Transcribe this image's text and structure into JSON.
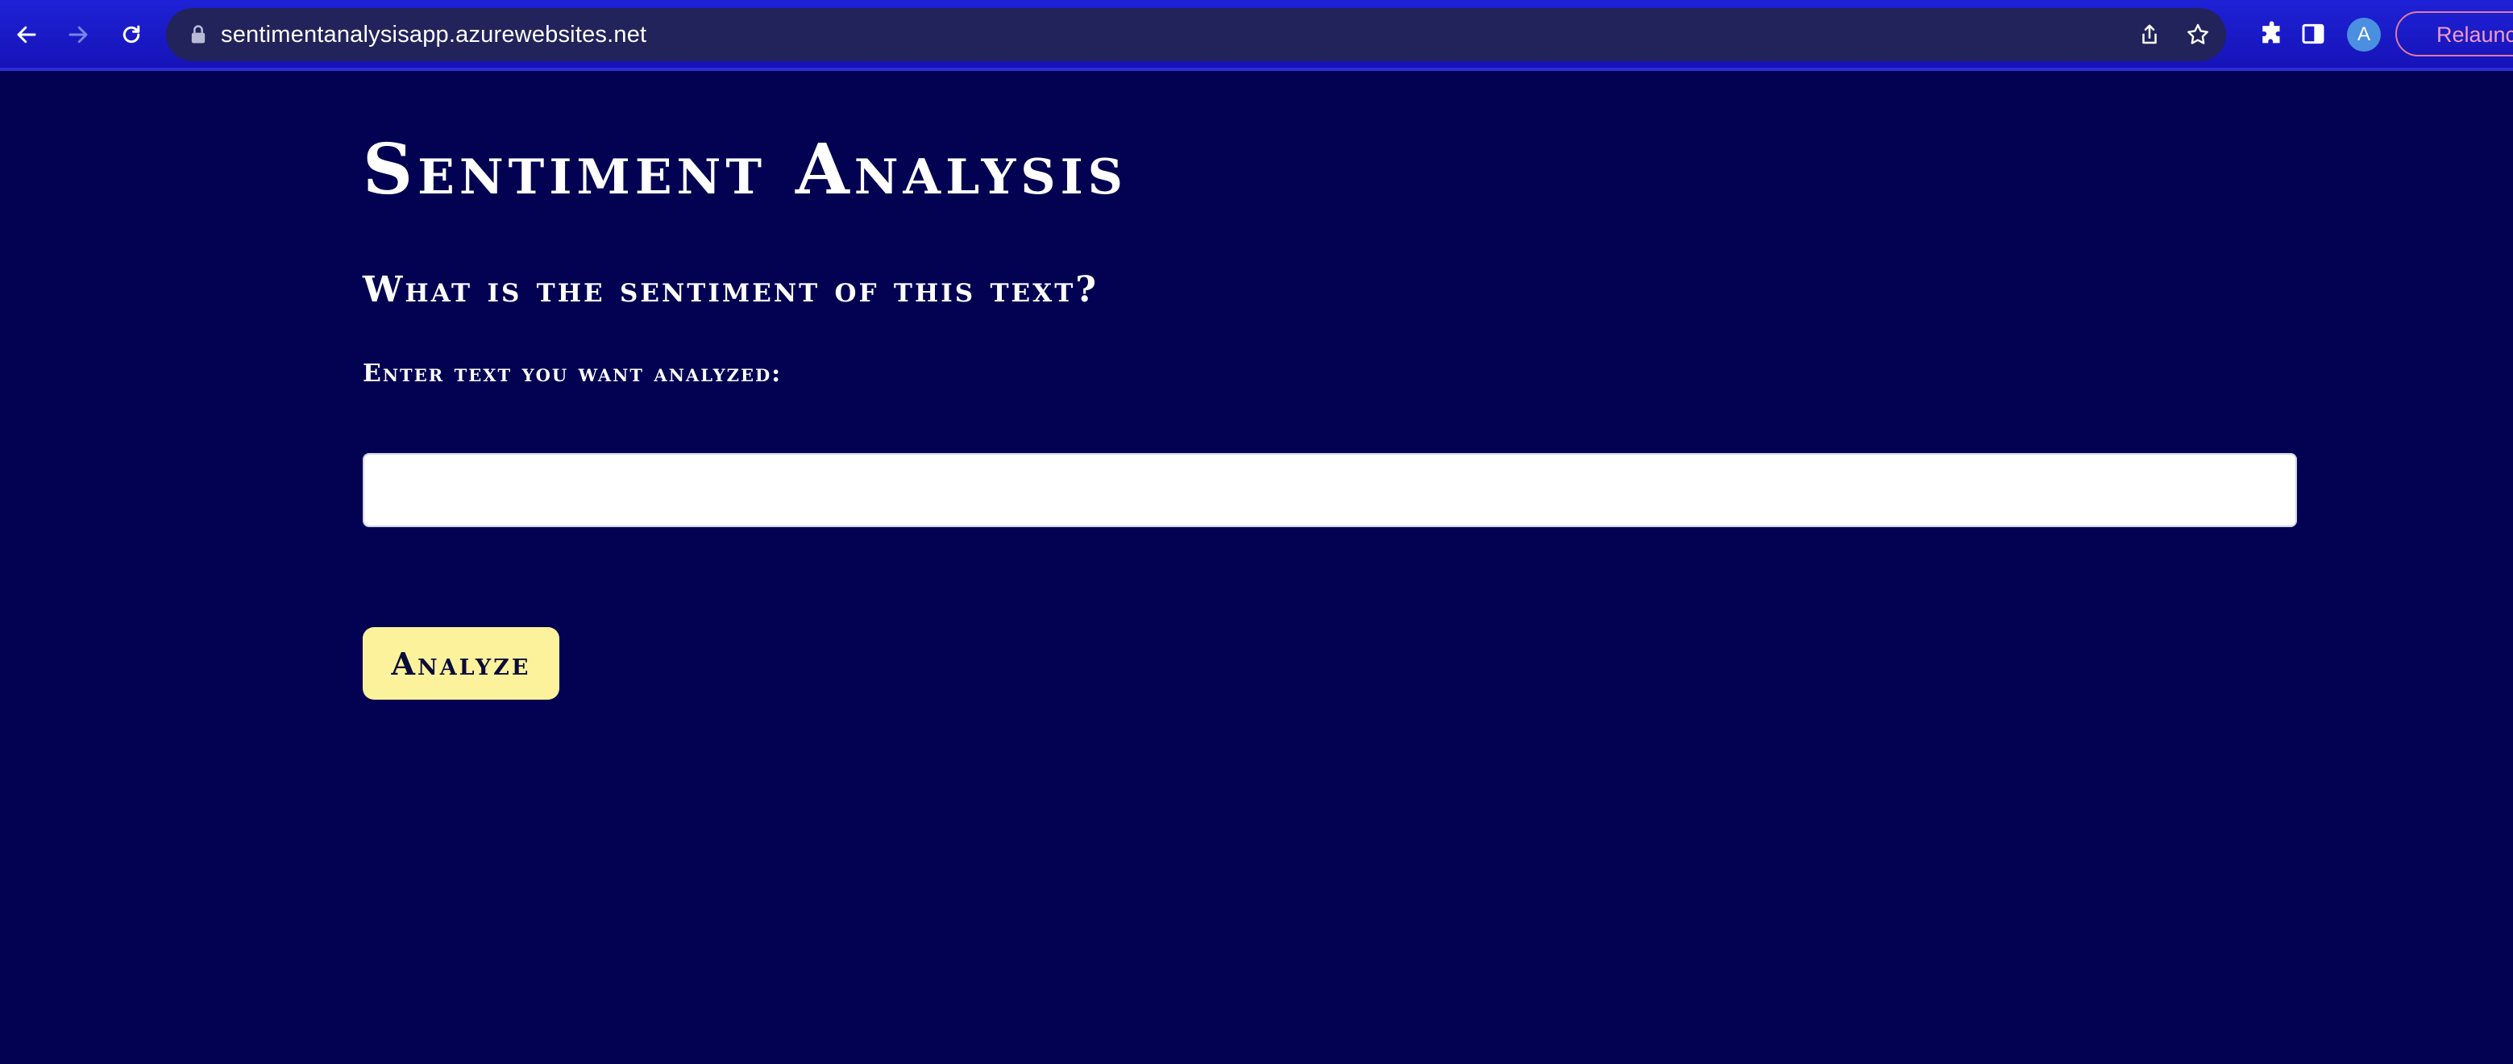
{
  "browser": {
    "url": "sentimentanalysisapp.azurewebsites.net",
    "profile_initial": "A",
    "relaunch_label": "Relaunch",
    "icons": [
      "back-arrow-icon",
      "forward-arrow-icon",
      "reload-icon",
      "lock-icon",
      "share-icon",
      "star-icon",
      "extensions-puzzle-icon",
      "side-panel-icon"
    ]
  },
  "page": {
    "title": "Sentiment Analysis",
    "question": "What is the sentiment of this text?",
    "input_label": "Enter text you want analyzed:",
    "input_value": "",
    "input_placeholder": "",
    "analyze_label": "Analyze"
  },
  "colors": {
    "background": "#020152",
    "toolbar": "#1b1bd0",
    "button_bg": "#fdf29c",
    "button_text": "#0b0b3a",
    "relaunch_border": "#e07aa0"
  }
}
